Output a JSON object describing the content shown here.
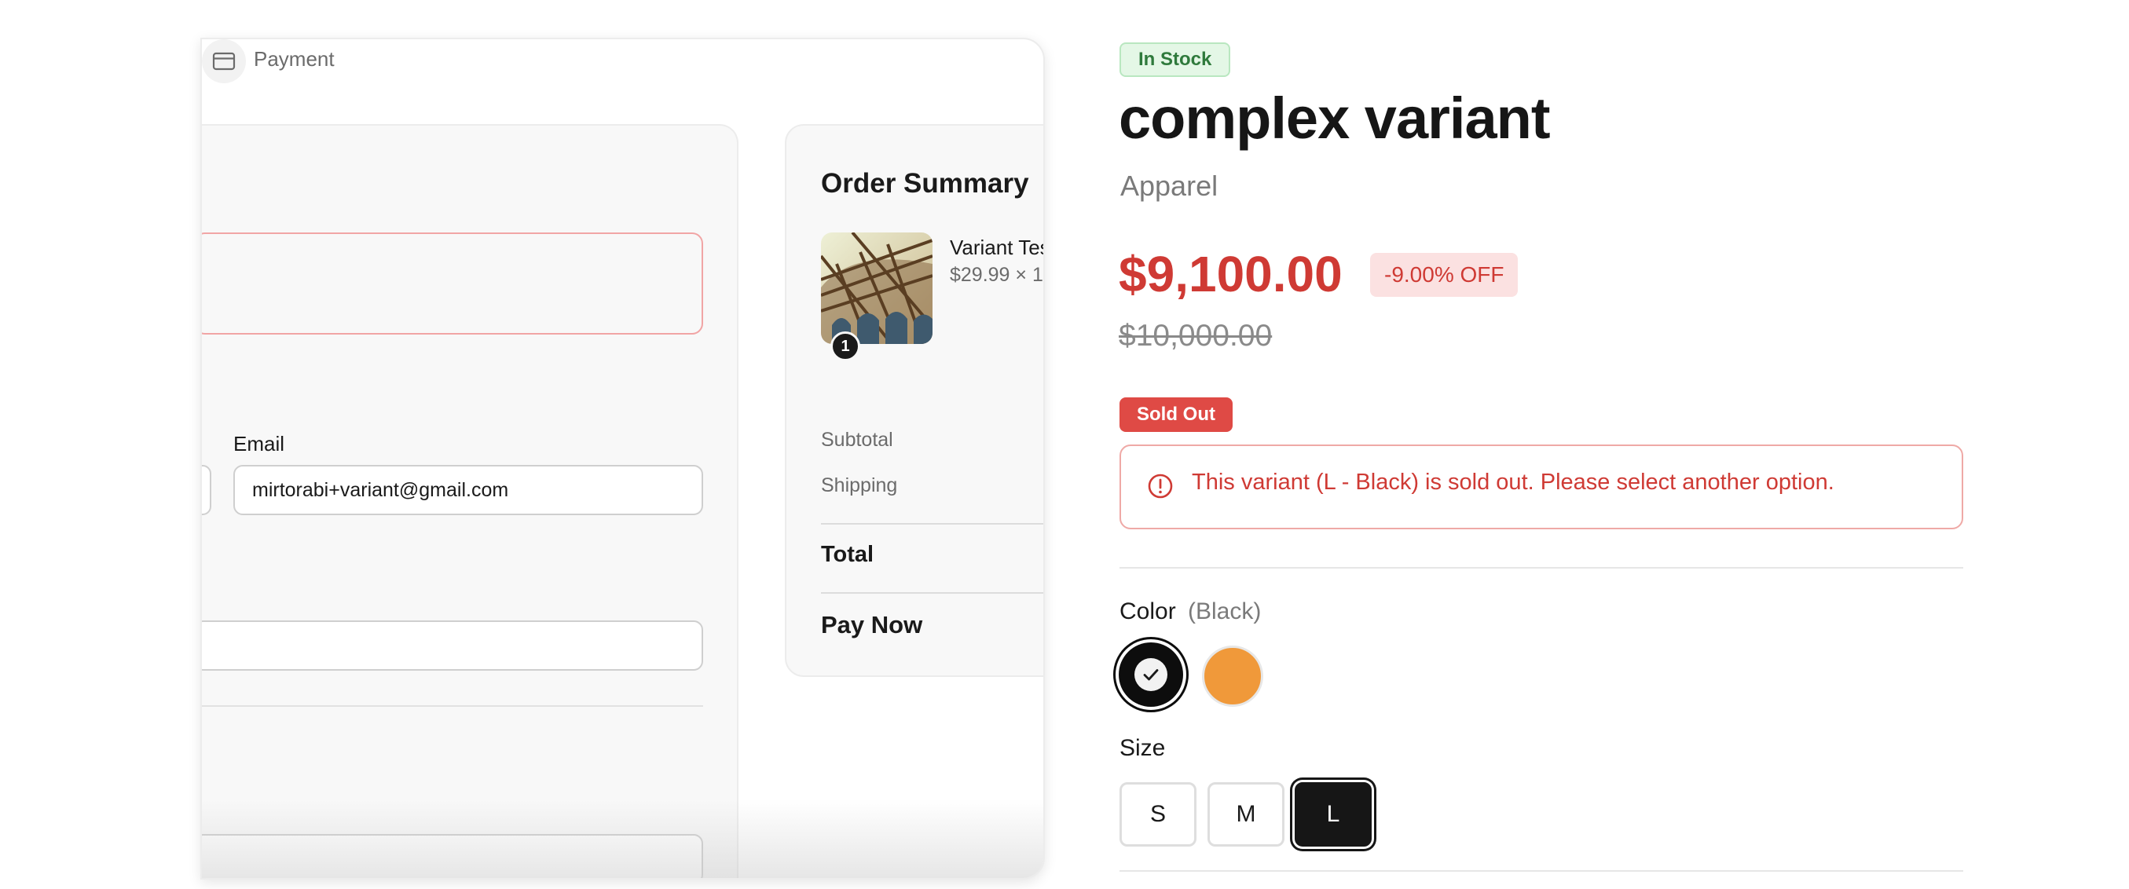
{
  "preview": {
    "header_title": "Payment",
    "email_label": "Email",
    "email_value": "mirtorabi+variant@gmail.com",
    "order_summary": {
      "title": "Order Summary",
      "item_name": "Variant Tes",
      "item_price": "$29.99 × 1",
      "quantity_badge": "1",
      "subtotal_label": "Subtotal",
      "shipping_label": "Shipping",
      "total_label": "Total",
      "pay_now_label": "Pay Now"
    }
  },
  "product": {
    "stock_status": "In Stock",
    "title": "complex variant",
    "category": "Apparel",
    "price": "$9,100.00",
    "discount": "-9.00% OFF",
    "compare_price": "$10,000.00",
    "sold_out_badge": "Sold Out",
    "alert_message": "This variant (L - Black) is sold out. Please select another option.",
    "color_label": "Color",
    "color_selected": "(Black)",
    "colors": [
      {
        "name": "Black",
        "hex": "#0d0d0d",
        "selected": true
      },
      {
        "name": "Orange",
        "hex": "#f0993a",
        "selected": false
      }
    ],
    "size_label": "Size",
    "sizes": [
      {
        "label": "S",
        "selected": false
      },
      {
        "label": "M",
        "selected": false
      },
      {
        "label": "L",
        "selected": true
      }
    ]
  },
  "colors": {
    "sale_red": "#cf3a34",
    "stock_green": "#2f7a3c",
    "sold_out_red": "#df4a45"
  }
}
